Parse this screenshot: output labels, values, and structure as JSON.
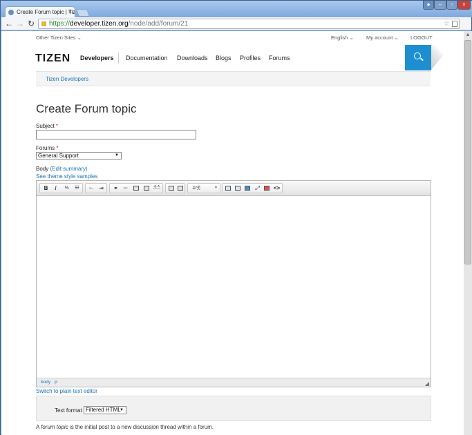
{
  "browser": {
    "tab_title": "Create Forum topic | Tize",
    "tab_close": "×",
    "url_secure": "https://",
    "url_domain": "developer.tizen.org",
    "url_path": "/node/add/forum/21",
    "window_controls": {
      "user": "●",
      "minimize": "–",
      "maximize": "▫",
      "close": "×"
    },
    "back": "←",
    "forward": "→",
    "reload": "↻",
    "star": "☆"
  },
  "site": {
    "utility": {
      "other_sites": "Other Tizen Sites ⌄",
      "language": "English ⌄",
      "account": "My account ⌄",
      "logout": "LOGOUT"
    },
    "logo": "TIZEN",
    "logo_sub": "Developers",
    "nav": [
      "Documentation",
      "Downloads",
      "Blogs",
      "Profiles",
      "Forums"
    ],
    "breadcrumb": "Tizen Developers"
  },
  "form": {
    "page_title": "Create Forum topic",
    "subject_label": "Subject",
    "required_mark": "*",
    "subject_value": "",
    "forums_label": "Forums",
    "forums_selected": "General Support",
    "body_label": "Body",
    "edit_summary": "(Edit summary)",
    "theme_samples": "See theme style samples",
    "editor_format": "포맷",
    "editor_path": [
      "body",
      "p"
    ],
    "switch_plain": "Switch to plain text editor",
    "text_format_label": "Text format",
    "text_format_selected": "Filtered HTML",
    "help_prefix": "A ",
    "help_em": "forum topic",
    "help_suffix": " is the initial post to a new discussion thread within a forum."
  },
  "editor_toolbar": {
    "bold": "B",
    "italic": "I",
    "ordered_list": "⅓",
    "bullet_list": "☷",
    "outdent": "⇤",
    "indent": "⇥",
    "link": "⚭",
    "unlink": "⚮",
    "image": "",
    "iframe": "",
    "source_small": "소스",
    "paste_text": "",
    "paste_word": "",
    "table": "",
    "special": "",
    "media": "",
    "maximize": "⤢",
    "strike": "",
    "code": "<>"
  }
}
